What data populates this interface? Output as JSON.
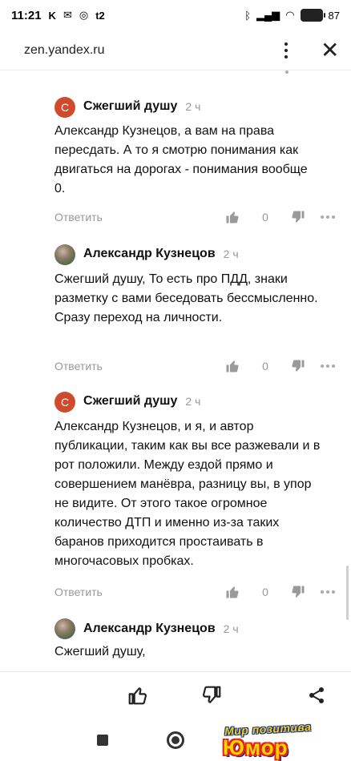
{
  "status_bar": {
    "time": "11:21",
    "icons_left": [
      "k-icon",
      "mail-icon",
      "vk-icon",
      "t2-icon"
    ],
    "t2_label": "t2",
    "battery": "87"
  },
  "browser": {
    "url": "zen.yandex.ru"
  },
  "comments": [
    {
      "avatar_letter": "С",
      "author": "Сжегший душу",
      "time": "2 ч",
      "text": "Александр Кузнецов, а вам на права пересдать. А то я смотрю понимания как двигаться на дорогах - понимания вообще 0.",
      "reply_label": "Ответить",
      "likes": "0"
    },
    {
      "author": "Александр Кузнецов",
      "time": "2 ч",
      "text": "Сжегший душу, То есть про ПДД, знаки разметку с вами беседовать бессмысленно. Сразу переход на личности.",
      "reply_label": "Ответить",
      "likes": "0"
    },
    {
      "avatar_letter": "С",
      "author": "Сжегший душу",
      "time": "2 ч",
      "text": "Александр Кузнецов, и я, и автор публикации, таким как вы все разжевали и в рот положили. Между ездой прямо и совершением манёвра, разницу вы, в упор не видите. От этого такое огромное количество ДТП и именно из-за таких баранов приходится простаивать в многочасовых пробках.",
      "reply_label": "Ответить",
      "likes": "0"
    },
    {
      "author": "Александр Кузнецов",
      "time": "2 ч",
      "text": "Сжегший душу,"
    }
  ],
  "watermark": {
    "top": "Мир позитива",
    "bottom": "Юмор"
  },
  "colors": {
    "avatar_letter_bg": "#d04a2c",
    "muted_text": "#999999",
    "watermark_yellow": "#ffd400"
  }
}
